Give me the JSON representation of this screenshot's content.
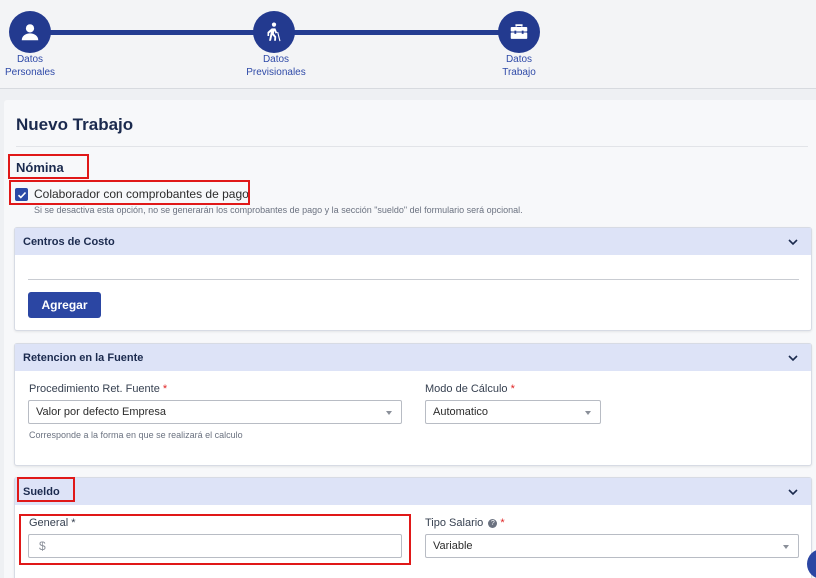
{
  "stepper": {
    "steps": [
      {
        "label": "Datos\nPersonales",
        "icon": "person-icon"
      },
      {
        "label": "Datos\nPrevisionales",
        "icon": "elderly-walking-icon"
      },
      {
        "label": "Datos\nTrabajo",
        "icon": "toolbox-icon"
      }
    ]
  },
  "form": {
    "title": "Nuevo Trabajo",
    "nomina": {
      "heading": "Nómina",
      "checkbox_label": "Colaborador con comprobantes de pago",
      "checkbox_checked": true,
      "help": "Si se desactiva esta opción, no se generarán los comprobantes de pago y la sección \"sueldo\" del formulario será opcional."
    },
    "centros_costo": {
      "title": "Centros de Costo",
      "button_label": "Agregar"
    },
    "retencion": {
      "title": "Retencion en la Fuente",
      "procedimiento_label": "Procedimiento Ret. Fuente",
      "procedimiento_value": "Valor por defecto Empresa",
      "procedimiento_hint": "Corresponde a la forma en que se realizará el calculo",
      "modo_label": "Modo de Cálculo",
      "modo_value": "Automatico",
      "required_mark": "*"
    },
    "sueldo": {
      "title": "Sueldo",
      "general_label": "General *",
      "general_prefix": "$",
      "general_value": "",
      "tipo_label": "Tipo Salario",
      "tipo_value": "Variable",
      "required_mark": "*"
    }
  },
  "colors": {
    "primary": "#233a8f",
    "panel_header": "#dde3f7",
    "highlight": "#e01818",
    "required": "#e02424"
  }
}
